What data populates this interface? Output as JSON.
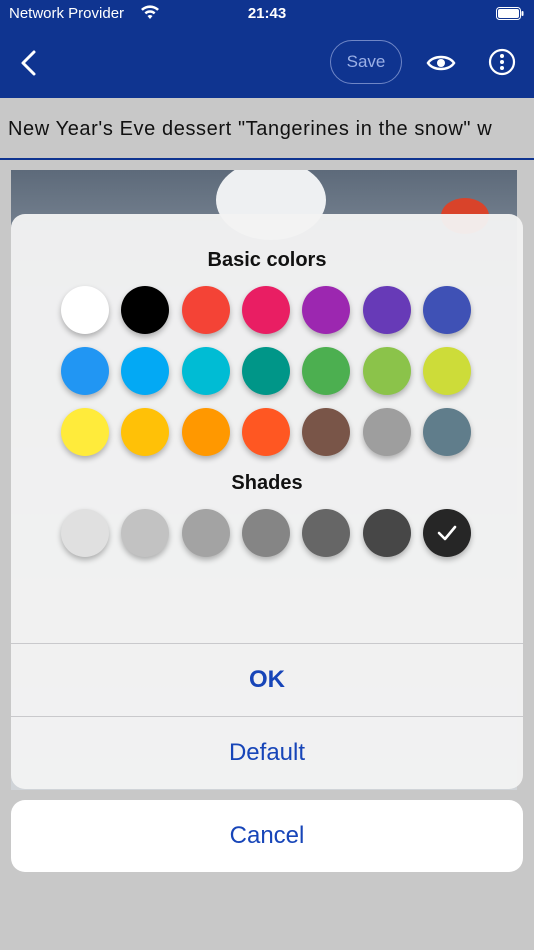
{
  "status_bar": {
    "provider": "Network Provider",
    "time": "21:43"
  },
  "toolbar": {
    "back_icon": "chevron-left-icon",
    "save_label": "Save",
    "preview_icon": "eye-icon",
    "more_icon": "more-vertical-icon"
  },
  "title_field": {
    "value": "New Year's Eve dessert \"Tangerines in the snow\" w"
  },
  "color_dialog": {
    "basic_heading": "Basic colors",
    "basic_colors": [
      [
        "#ffffff",
        "#000000",
        "#f44336",
        "#e91e63",
        "#9c27b0",
        "#673ab7",
        "#3f51b5"
      ],
      [
        "#2196f3",
        "#03a9f4",
        "#00bcd4",
        "#009688",
        "#4caf50",
        "#8bc34a",
        "#cddc39"
      ],
      [
        "#ffeb3b",
        "#ffc107",
        "#ff9800",
        "#ff5722",
        "#795548",
        "#9e9e9e",
        "#607d8b"
      ]
    ],
    "shades_heading": "Shades",
    "shades": [
      "#e0e0e0",
      "#c2c2c2",
      "#a3a3a3",
      "#858585",
      "#666666",
      "#474747",
      "#262626"
    ],
    "selected_shade_index": 6,
    "ok_label": "OK",
    "default_label": "Default"
  },
  "cancel_label": "Cancel"
}
